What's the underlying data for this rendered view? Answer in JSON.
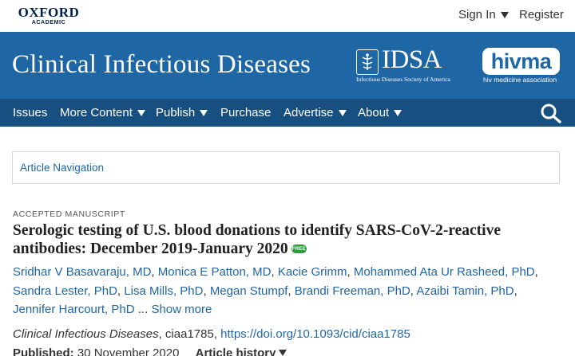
{
  "brand": {
    "publisher": "OXFORD",
    "publisher_sub": "ACADEMIC"
  },
  "account": {
    "sign_in": "Sign In",
    "register": "Register"
  },
  "header": {
    "journal_title": "Clinical Infectious Diseases",
    "idsa": {
      "wordmark": "IDSA",
      "subtitle": "Infectious Diseases Society of America"
    },
    "hivma": {
      "wordmark": "hivma",
      "subtitle": "hiv medicine association"
    }
  },
  "nav": {
    "items": [
      {
        "label": "Issues",
        "dropdown": false
      },
      {
        "label": "More Content",
        "dropdown": true
      },
      {
        "label": "Publish",
        "dropdown": true
      },
      {
        "label": "Purchase",
        "dropdown": false
      },
      {
        "label": "Advertise",
        "dropdown": true
      },
      {
        "label": "About",
        "dropdown": true
      }
    ],
    "search_icon": "search-icon"
  },
  "article_nav": {
    "label": "Article Navigation"
  },
  "article": {
    "type": "ACCEPTED MANUSCRIPT",
    "title": "Serologic testing of U.S. blood donations to identify SARS-CoV-2-reactive antibodies: December 2019-January 2020",
    "badge": "FREE",
    "authors": [
      "Sridhar V Basavaraju, MD",
      "Monica E Patton, MD",
      "Kacie Grimm",
      "Mohammed Ata Ur Rasheed, PhD",
      "Sandra Lester, PhD",
      "Lisa Mills, PhD",
      "Megan Stumpf",
      "Brandi Freeman, PhD",
      "Azaibi Tamin, PhD",
      "Jennifer Harcourt, PhD"
    ],
    "ellipsis": "...",
    "show_more": "Show more",
    "journal": "Clinical Infectious Diseases",
    "article_id": "ciaa1785",
    "doi": "https://doi.org/10.1093/cid/ciaa1785",
    "published_label": "Published:",
    "published_date": "30 November 2020",
    "history_label": "Article history"
  },
  "colors": {
    "brand_blue": "#1f66a4",
    "nav_blue": "#164f80",
    "link": "#1f66a4",
    "free_badge": "#2b9b3c"
  }
}
